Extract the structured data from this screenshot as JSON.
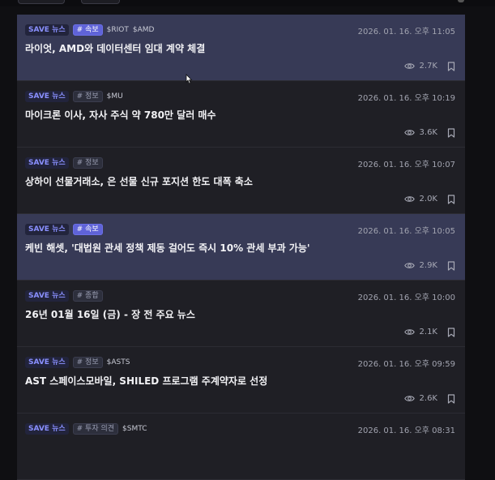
{
  "feed": {
    "items": [
      {
        "source": "SAVE 뉴스",
        "category": "# 속보",
        "category_type": "breaking",
        "tickers": [
          "$RIOT",
          "$AMD"
        ],
        "date": "2026. 01. 16. 오후 11:05",
        "title": "라이엇, AMD와 데이터센터 임대 계약 체결",
        "views": "2.7K",
        "highlighted": true
      },
      {
        "source": "SAVE 뉴스",
        "category": "# 정보",
        "category_type": "info",
        "tickers": [
          "$MU"
        ],
        "date": "2026. 01. 16. 오후 10:19",
        "title": "마이크론 이사, 자사 주식 약 780만 달러 매수",
        "views": "3.6K",
        "highlighted": false
      },
      {
        "source": "SAVE 뉴스",
        "category": "# 정보",
        "category_type": "info",
        "tickers": [],
        "date": "2026. 01. 16. 오후 10:07",
        "title": "상하이 선물거래소, 은 선물 신규 포지션 한도 대폭 축소",
        "views": "2.0K",
        "highlighted": false
      },
      {
        "source": "SAVE 뉴스",
        "category": "# 속보",
        "category_type": "breaking",
        "tickers": [],
        "date": "2026. 01. 16. 오후 10:05",
        "title": "케빈 해셋, '대법원 관세 정책 제동 걸어도 즉시 10% 관세 부과 가능'",
        "views": "2.9K",
        "highlighted": true
      },
      {
        "source": "SAVE 뉴스",
        "category": "# 종합",
        "category_type": "general",
        "tickers": [],
        "date": "2026. 01. 16. 오후 10:00",
        "title": "26년 01월 16일 (금) - 장 전 주요 뉴스",
        "views": "2.1K",
        "highlighted": false
      },
      {
        "source": "SAVE 뉴스",
        "category": "# 정보",
        "category_type": "info",
        "tickers": [
          "$ASTS"
        ],
        "date": "2026. 01. 16. 오후 09:59",
        "title": "AST 스페이스모바일, SHILED 프로그램 주계약자로 선정",
        "views": "2.6K",
        "highlighted": false
      },
      {
        "source": "SAVE 뉴스",
        "category": "# 투자 의견",
        "category_type": "opinion",
        "tickers": [
          "$SMTC"
        ],
        "date": "2026. 01. 16. 오후 08:31",
        "title": "",
        "views": "",
        "highlighted": false
      }
    ]
  },
  "icons": {
    "views": "eye-icon",
    "bookmark": "bookmark-icon",
    "cursor": "mouse-cursor-icon"
  },
  "colors": {
    "background": "#0f0f12",
    "card": "#1f1f25",
    "card_highlight": "#373a56",
    "accent": "#8a90ff",
    "breaking_tag": "#5f63d8"
  }
}
